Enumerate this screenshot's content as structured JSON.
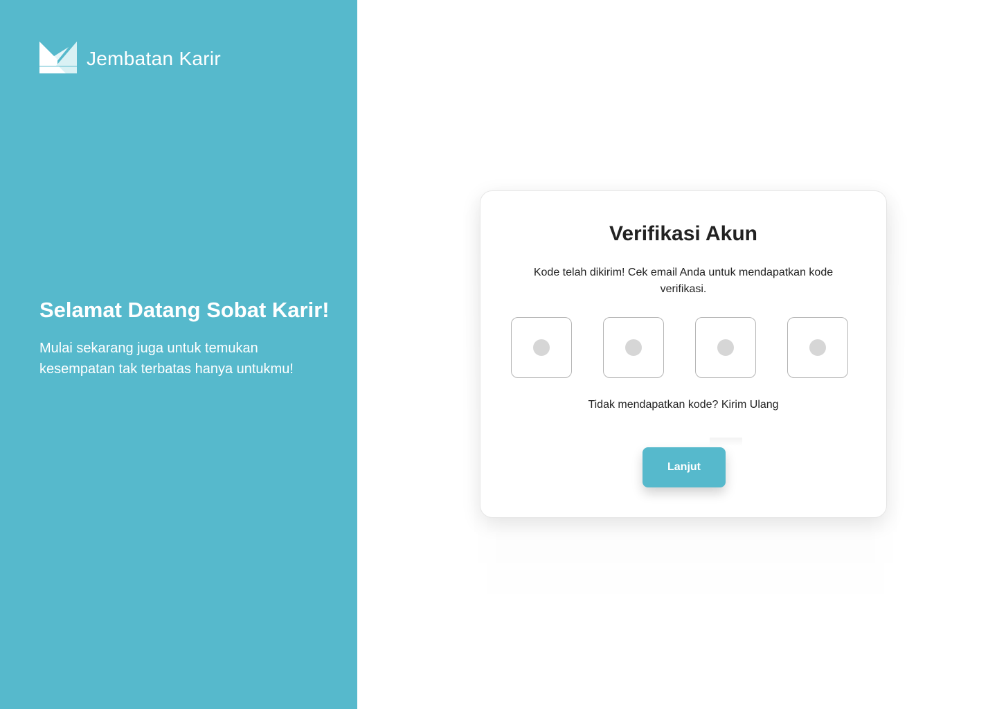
{
  "colors": {
    "brand": "#56B9CC",
    "brand_light": "#D9F1F4",
    "text_dark": "#222222"
  },
  "brand": {
    "name": "Jembatan Karir",
    "logo_icon": "jembatan-karir-logo-icon"
  },
  "welcome": {
    "title": "Selamat Datang Sobat Karir!",
    "subtitle": "Mulai sekarang juga untuk temukan kesempatan tak terbatas hanya untukmu!"
  },
  "verification": {
    "title": "Verifikasi Akun",
    "description": "Kode telah dikirim! Cek email Anda untuk mendapatkan kode verifikasi.",
    "code_fields": [
      {
        "value": ""
      },
      {
        "value": ""
      },
      {
        "value": ""
      },
      {
        "value": ""
      }
    ],
    "resend_prompt": "Tidak mendapatkan kode?",
    "resend_link": "Kirim Ulang",
    "continue_label": "Lanjut"
  }
}
